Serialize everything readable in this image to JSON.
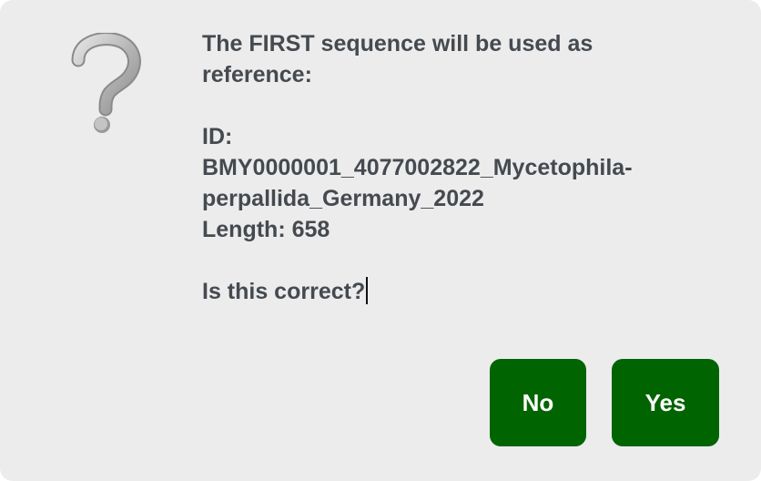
{
  "dialog": {
    "icon": "question-mark-icon",
    "message": {
      "heading_line1": "The FIRST sequence will be used as",
      "heading_line2": "reference:",
      "id_label": "ID:",
      "id_value_line1": "BMY0000001_4077002822_Mycetophila-",
      "id_value_line2": "perpallida_Germany_2022",
      "length": "Length: 658",
      "question": "Is this correct?"
    },
    "buttons": {
      "no_label": "No",
      "yes_label": "Yes"
    },
    "colors": {
      "background": "#ececec",
      "text": "#454a50",
      "button": "#006400",
      "button_text": "#ffffff"
    }
  }
}
